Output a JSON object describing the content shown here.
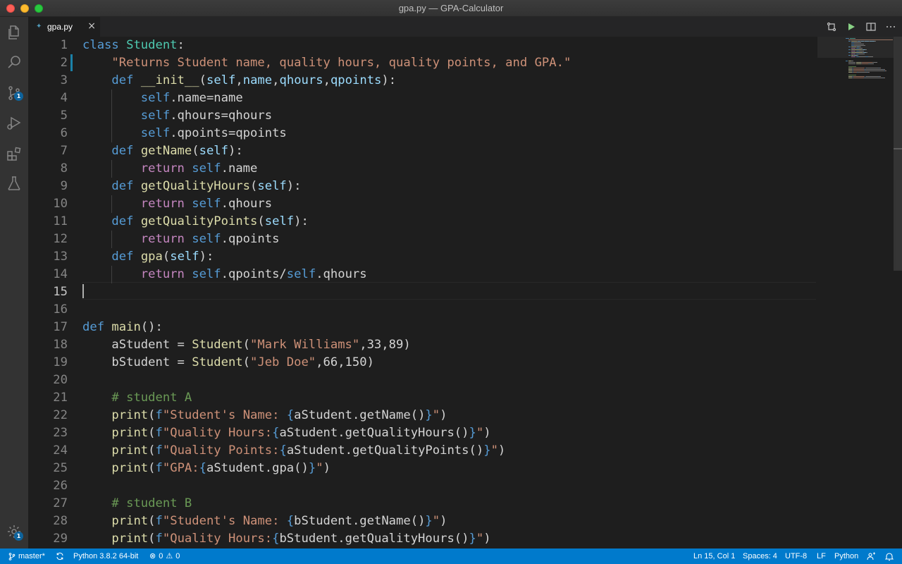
{
  "window": {
    "title": "gpa.py — GPA-Calculator"
  },
  "activity_bar": {
    "items": [
      {
        "name": "explorer-icon"
      },
      {
        "name": "search-icon"
      },
      {
        "name": "source-control-icon",
        "badge": "1"
      },
      {
        "name": "run-debug-icon"
      },
      {
        "name": "extensions-icon"
      },
      {
        "name": "testing-icon"
      }
    ],
    "settings_badge": "1"
  },
  "tabs": [
    {
      "label": "gpa.py",
      "active": true
    }
  ],
  "editor": {
    "active_line": 15,
    "lines": [
      {
        "num": "1",
        "tokens": [
          [
            "kw",
            "class "
          ],
          [
            "cls",
            "Student"
          ],
          [
            "txt",
            ":"
          ]
        ]
      },
      {
        "num": "2",
        "tokens": [
          [
            "txt",
            "    "
          ],
          [
            "str",
            "\"Returns Student name, quality hours, quality points, and GPA.\""
          ]
        ]
      },
      {
        "num": "3",
        "tokens": [
          [
            "txt",
            "    "
          ],
          [
            "kw",
            "def "
          ],
          [
            "fn",
            "__init__"
          ],
          [
            "txt",
            "("
          ],
          [
            "prm",
            "self"
          ],
          [
            "txt",
            ","
          ],
          [
            "prm",
            "name"
          ],
          [
            "txt",
            ","
          ],
          [
            "prm",
            "qhours"
          ],
          [
            "txt",
            ","
          ],
          [
            "prm",
            "qpoints"
          ],
          [
            "txt",
            "):"
          ]
        ]
      },
      {
        "num": "4",
        "tokens": [
          [
            "txt",
            "        "
          ],
          [
            "kw",
            "self"
          ],
          [
            "txt",
            ".name=name"
          ]
        ]
      },
      {
        "num": "5",
        "tokens": [
          [
            "txt",
            "        "
          ],
          [
            "kw",
            "self"
          ],
          [
            "txt",
            ".qhours=qhours"
          ]
        ]
      },
      {
        "num": "6",
        "tokens": [
          [
            "txt",
            "        "
          ],
          [
            "kw",
            "self"
          ],
          [
            "txt",
            ".qpoints=qpoints"
          ]
        ]
      },
      {
        "num": "7",
        "tokens": [
          [
            "txt",
            "    "
          ],
          [
            "kw",
            "def "
          ],
          [
            "fn",
            "getName"
          ],
          [
            "txt",
            "("
          ],
          [
            "prm",
            "self"
          ],
          [
            "txt",
            "):"
          ]
        ]
      },
      {
        "num": "8",
        "tokens": [
          [
            "txt",
            "        "
          ],
          [
            "ctl",
            "return "
          ],
          [
            "kw",
            "self"
          ],
          [
            "txt",
            ".name"
          ]
        ]
      },
      {
        "num": "9",
        "tokens": [
          [
            "txt",
            "    "
          ],
          [
            "kw",
            "def "
          ],
          [
            "fn",
            "getQualityHours"
          ],
          [
            "txt",
            "("
          ],
          [
            "prm",
            "self"
          ],
          [
            "txt",
            "):"
          ]
        ]
      },
      {
        "num": "10",
        "tokens": [
          [
            "txt",
            "        "
          ],
          [
            "ctl",
            "return "
          ],
          [
            "kw",
            "self"
          ],
          [
            "txt",
            ".qhours"
          ]
        ]
      },
      {
        "num": "11",
        "tokens": [
          [
            "txt",
            "    "
          ],
          [
            "kw",
            "def "
          ],
          [
            "fn",
            "getQualityPoints"
          ],
          [
            "txt",
            "("
          ],
          [
            "prm",
            "self"
          ],
          [
            "txt",
            "):"
          ]
        ]
      },
      {
        "num": "12",
        "tokens": [
          [
            "txt",
            "        "
          ],
          [
            "ctl",
            "return "
          ],
          [
            "kw",
            "self"
          ],
          [
            "txt",
            ".qpoints"
          ]
        ]
      },
      {
        "num": "13",
        "tokens": [
          [
            "txt",
            "    "
          ],
          [
            "kw",
            "def "
          ],
          [
            "fn",
            "gpa"
          ],
          [
            "txt",
            "("
          ],
          [
            "prm",
            "self"
          ],
          [
            "txt",
            "):"
          ]
        ]
      },
      {
        "num": "14",
        "tokens": [
          [
            "txt",
            "        "
          ],
          [
            "ctl",
            "return "
          ],
          [
            "kw",
            "self"
          ],
          [
            "txt",
            ".qpoints/"
          ],
          [
            "kw",
            "self"
          ],
          [
            "txt",
            ".qhours"
          ]
        ]
      },
      {
        "num": "15",
        "tokens": []
      },
      {
        "num": "16",
        "tokens": []
      },
      {
        "num": "17",
        "tokens": [
          [
            "kw",
            "def "
          ],
          [
            "fn",
            "main"
          ],
          [
            "txt",
            "():"
          ]
        ]
      },
      {
        "num": "18",
        "tokens": [
          [
            "txt",
            "    aStudent = "
          ],
          [
            "fn",
            "Student"
          ],
          [
            "txt",
            "("
          ],
          [
            "str",
            "\"Mark Williams\""
          ],
          [
            "txt",
            ",33,89)"
          ]
        ]
      },
      {
        "num": "19",
        "tokens": [
          [
            "txt",
            "    bStudent = "
          ],
          [
            "fn",
            "Student"
          ],
          [
            "txt",
            "("
          ],
          [
            "str",
            "\"Jeb Doe\""
          ],
          [
            "txt",
            ",66,150)"
          ]
        ]
      },
      {
        "num": "20",
        "tokens": []
      },
      {
        "num": "21",
        "tokens": [
          [
            "txt",
            "    "
          ],
          [
            "cmt",
            "# student A"
          ]
        ]
      },
      {
        "num": "22",
        "tokens": [
          [
            "txt",
            "    "
          ],
          [
            "fn",
            "print"
          ],
          [
            "txt",
            "("
          ],
          [
            "kw",
            "f"
          ],
          [
            "str",
            "\"Student's Name: "
          ],
          [
            "brk",
            "{"
          ],
          [
            "txt",
            "aStudent.getName()"
          ],
          [
            "brk",
            "}"
          ],
          [
            "str",
            "\""
          ],
          [
            "txt",
            ")"
          ]
        ]
      },
      {
        "num": "23",
        "tokens": [
          [
            "txt",
            "    "
          ],
          [
            "fn",
            "print"
          ],
          [
            "txt",
            "("
          ],
          [
            "kw",
            "f"
          ],
          [
            "str",
            "\"Quality Hours:"
          ],
          [
            "brk",
            "{"
          ],
          [
            "txt",
            "aStudent.getQualityHours()"
          ],
          [
            "brk",
            "}"
          ],
          [
            "str",
            "\""
          ],
          [
            "txt",
            ")"
          ]
        ]
      },
      {
        "num": "24",
        "tokens": [
          [
            "txt",
            "    "
          ],
          [
            "fn",
            "print"
          ],
          [
            "txt",
            "("
          ],
          [
            "kw",
            "f"
          ],
          [
            "str",
            "\"Quality Points:"
          ],
          [
            "brk",
            "{"
          ],
          [
            "txt",
            "aStudent.getQualityPoints()"
          ],
          [
            "brk",
            "}"
          ],
          [
            "str",
            "\""
          ],
          [
            "txt",
            ")"
          ]
        ]
      },
      {
        "num": "25",
        "tokens": [
          [
            "txt",
            "    "
          ],
          [
            "fn",
            "print"
          ],
          [
            "txt",
            "("
          ],
          [
            "kw",
            "f"
          ],
          [
            "str",
            "\"GPA:"
          ],
          [
            "brk",
            "{"
          ],
          [
            "txt",
            "aStudent.gpa()"
          ],
          [
            "brk",
            "}"
          ],
          [
            "str",
            "\""
          ],
          [
            "txt",
            ")"
          ]
        ]
      },
      {
        "num": "26",
        "tokens": []
      },
      {
        "num": "27",
        "tokens": [
          [
            "txt",
            "    "
          ],
          [
            "cmt",
            "# student B"
          ]
        ]
      },
      {
        "num": "28",
        "tokens": [
          [
            "txt",
            "    "
          ],
          [
            "fn",
            "print"
          ],
          [
            "txt",
            "("
          ],
          [
            "kw",
            "f"
          ],
          [
            "str",
            "\"Student's Name: "
          ],
          [
            "brk",
            "{"
          ],
          [
            "txt",
            "bStudent.getName()"
          ],
          [
            "brk",
            "}"
          ],
          [
            "str",
            "\""
          ],
          [
            "txt",
            ")"
          ]
        ]
      },
      {
        "num": "29",
        "tokens": [
          [
            "txt",
            "    "
          ],
          [
            "fn",
            "print"
          ],
          [
            "txt",
            "("
          ],
          [
            "kw",
            "f"
          ],
          [
            "str",
            "\"Quality Hours:"
          ],
          [
            "brk",
            "{"
          ],
          [
            "txt",
            "bStudent.getQualityHours()"
          ],
          [
            "brk",
            "}"
          ],
          [
            "str",
            "\""
          ],
          [
            "txt",
            ")"
          ]
        ]
      }
    ]
  },
  "status_bar": {
    "branch": "master*",
    "interpreter": "Python 3.8.2 64-bit",
    "errors": "0",
    "warnings": "0",
    "cursor_position": "Ln 15, Col 1",
    "indentation": "Spaces: 4",
    "encoding": "UTF-8",
    "line_ending": "LF",
    "language": "Python"
  },
  "colors": {
    "accent": "#007acc",
    "keyword": "#569cd6",
    "class": "#4ec9b0",
    "string": "#ce9178",
    "function": "#dcdcaa",
    "parameter": "#9cdcfe",
    "control": "#c586c0",
    "comment": "#6a9955"
  }
}
